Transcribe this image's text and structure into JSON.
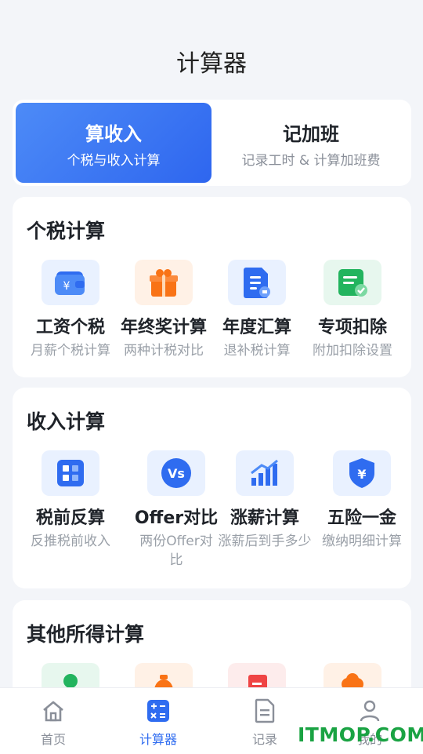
{
  "page": {
    "title": "计算器"
  },
  "segment": {
    "tabs": [
      {
        "title": "算收入",
        "subtitle": "个税与收入计算"
      },
      {
        "title": "记加班",
        "subtitle": "记录工时 & 计算加班费"
      }
    ]
  },
  "sections": [
    {
      "title": "个税计算",
      "items": [
        {
          "label": "工资个税",
          "desc": "月薪个税计算",
          "icon": "wallet-icon"
        },
        {
          "label": "年终奖计算",
          "desc": "两种计税对比",
          "icon": "gift-icon"
        },
        {
          "label": "年度汇算",
          "desc": "退补税计算",
          "icon": "document-icon"
        },
        {
          "label": "专项扣除",
          "desc": "附加扣除设置",
          "icon": "checklist-icon"
        }
      ]
    },
    {
      "title": "收入计算",
      "items": [
        {
          "label": "税前反算",
          "desc": "反推税前收入",
          "icon": "blocks-icon"
        },
        {
          "label": "Offer对比",
          "desc": "两份Offer对比",
          "icon": "vs-icon"
        },
        {
          "label": "涨薪计算",
          "desc": "涨薪后到手多少",
          "icon": "growth-chart-icon"
        },
        {
          "label": "五险一金",
          "desc": "缴纳明细计算",
          "icon": "shield-yen-icon"
        }
      ]
    },
    {
      "title": "其他所得计算"
    }
  ],
  "tabbar": {
    "items": [
      {
        "label": "首页",
        "icon": "home-icon"
      },
      {
        "label": "计算器",
        "icon": "calculator-icon",
        "active": true
      },
      {
        "label": "记录",
        "icon": "record-icon"
      },
      {
        "label": "我的",
        "icon": "user-icon"
      }
    ]
  },
  "watermark": {
    "text": "ITMOP.COM"
  },
  "colors": {
    "accent": "#2f6cf0",
    "watermark": "#1aa343"
  }
}
